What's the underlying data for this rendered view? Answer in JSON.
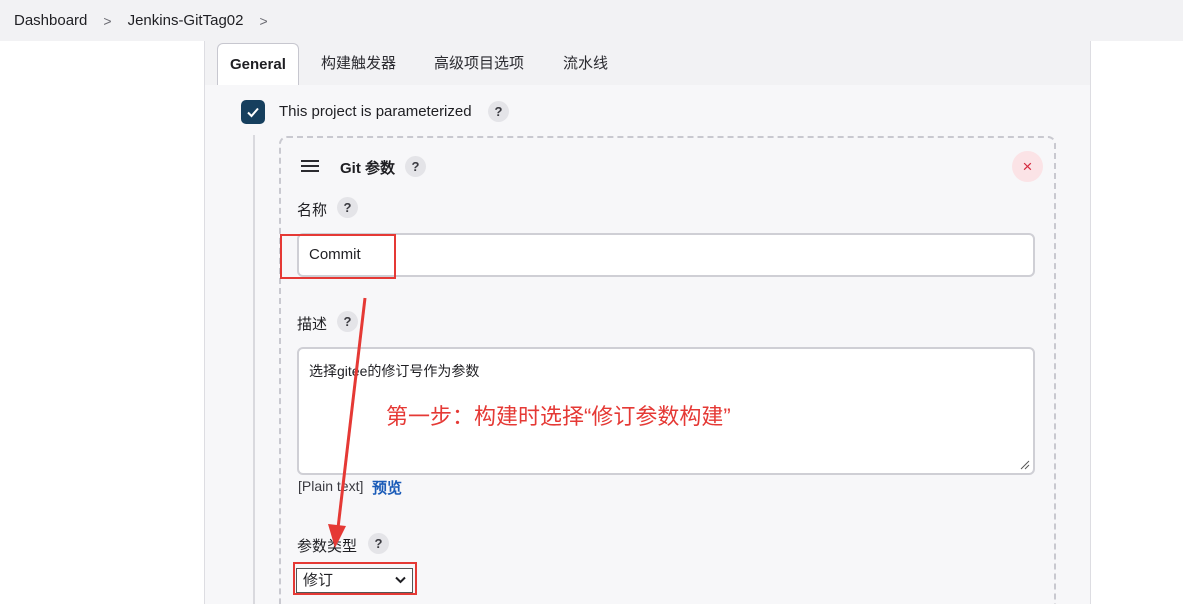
{
  "breadcrumb": {
    "items": [
      "Dashboard",
      "Jenkins-GitTag02"
    ],
    "separator": ">"
  },
  "tabs": [
    {
      "label": "General",
      "active": true
    },
    {
      "label": "构建触发器",
      "active": false
    },
    {
      "label": "高级项目选项",
      "active": false
    },
    {
      "label": "流水线",
      "active": false
    }
  ],
  "parameterized": {
    "label": "This project is parameterized",
    "checked": true,
    "help": "?"
  },
  "git_param": {
    "title": "Git 参数",
    "help": "?",
    "close_icon": "×",
    "name": {
      "label": "名称",
      "help": "?",
      "value": "Commit"
    },
    "description": {
      "label": "描述",
      "help": "?",
      "value": "选择gitee的修订号作为参数",
      "plain_text": "[Plain text]",
      "preview_link": "预览"
    },
    "param_type": {
      "label": "参数类型",
      "help": "?",
      "selected": "修订"
    }
  },
  "annotation": {
    "text": "第一步：构建时选择“修订参数构建”",
    "color": "#e53935"
  },
  "colors": {
    "checkbox": "#163f5e",
    "link": "#1a5bb8",
    "close": "#d52a3f"
  }
}
